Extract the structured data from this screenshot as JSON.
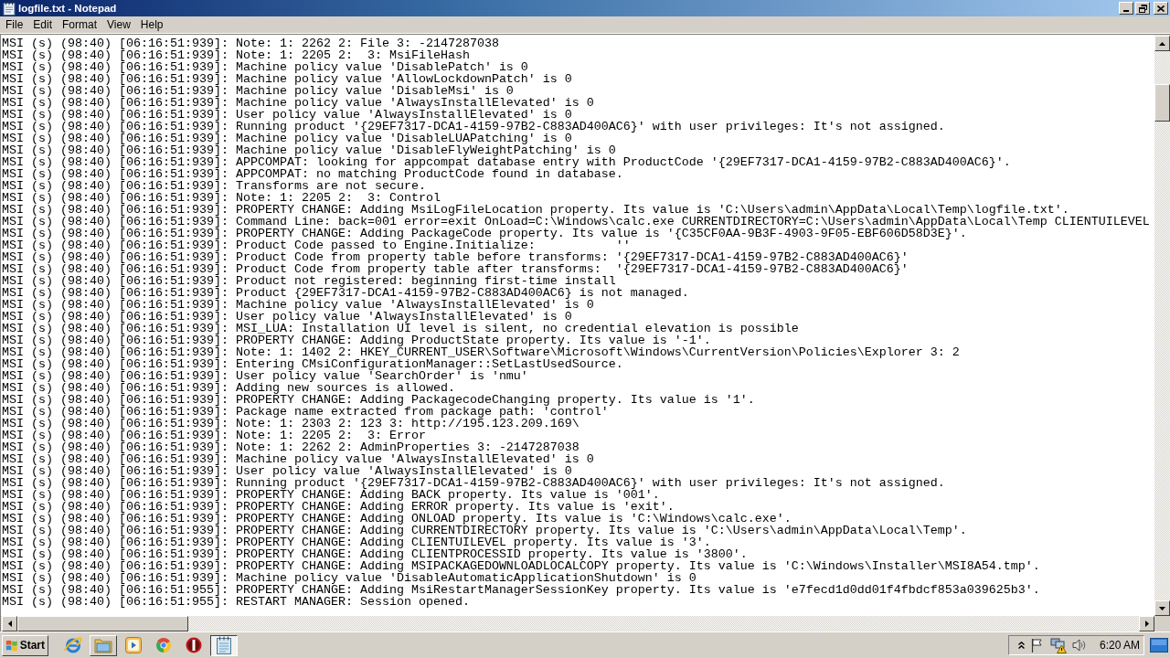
{
  "window": {
    "title": "logfile.txt - Notepad"
  },
  "menu": [
    "File",
    "Edit",
    "Format",
    "View",
    "Help"
  ],
  "document": {
    "lines": [
      "MSI (s) (98:40) [06:16:51:939]: Note: 1: 2262 2: File 3: -2147287038",
      "MSI (s) (98:40) [06:16:51:939]: Note: 1: 2205 2:  3: MsiFileHash",
      "MSI (s) (98:40) [06:16:51:939]: Machine policy value 'DisablePatch' is 0",
      "MSI (s) (98:40) [06:16:51:939]: Machine policy value 'AllowLockdownPatch' is 0",
      "MSI (s) (98:40) [06:16:51:939]: Machine policy value 'DisableMsi' is 0",
      "MSI (s) (98:40) [06:16:51:939]: Machine policy value 'AlwaysInstallElevated' is 0",
      "MSI (s) (98:40) [06:16:51:939]: User policy value 'AlwaysInstallElevated' is 0",
      "MSI (s) (98:40) [06:16:51:939]: Running product '{29EF7317-DCA1-4159-97B2-C883AD400AC6}' with user privileges: It's not assigned.",
      "MSI (s) (98:40) [06:16:51:939]: Machine policy value 'DisableLUAPatching' is 0",
      "MSI (s) (98:40) [06:16:51:939]: Machine policy value 'DisableFlyWeightPatching' is 0",
      "MSI (s) (98:40) [06:16:51:939]: APPCOMPAT: looking for appcompat database entry with ProductCode '{29EF7317-DCA1-4159-97B2-C883AD400AC6}'.",
      "MSI (s) (98:40) [06:16:51:939]: APPCOMPAT: no matching ProductCode found in database.",
      "MSI (s) (98:40) [06:16:51:939]: Transforms are not secure.",
      "MSI (s) (98:40) [06:16:51:939]: Note: 1: 2205 2:  3: Control",
      "MSI (s) (98:40) [06:16:51:939]: PROPERTY CHANGE: Adding MsiLogFileLocation property. Its value is 'C:\\Users\\admin\\AppData\\Local\\Temp\\logfile.txt'.",
      "MSI (s) (98:40) [06:16:51:939]: Command Line: back=001 error=exit OnLoad=C:\\Windows\\calc.exe CURRENTDIRECTORY=C:\\Users\\admin\\AppData\\Local\\Temp CLIENTUILEVEL",
      "MSI (s) (98:40) [06:16:51:939]: PROPERTY CHANGE: Adding PackageCode property. Its value is '{C35CF0AA-9B3F-4903-9F05-EBF606D58D3E}'.",
      "MSI (s) (98:40) [06:16:51:939]: Product Code passed to Engine.Initialize:           ''",
      "MSI (s) (98:40) [06:16:51:939]: Product Code from property table before transforms: '{29EF7317-DCA1-4159-97B2-C883AD400AC6}'",
      "MSI (s) (98:40) [06:16:51:939]: Product Code from property table after transforms:  '{29EF7317-DCA1-4159-97B2-C883AD400AC6}'",
      "MSI (s) (98:40) [06:16:51:939]: Product not registered: beginning first-time install",
      "MSI (s) (98:40) [06:16:51:939]: Product {29EF7317-DCA1-4159-97B2-C883AD400AC6} is not managed.",
      "MSI (s) (98:40) [06:16:51:939]: Machine policy value 'AlwaysInstallElevated' is 0",
      "MSI (s) (98:40) [06:16:51:939]: User policy value 'AlwaysInstallElevated' is 0",
      "MSI (s) (98:40) [06:16:51:939]: MSI_LUA: Installation UI level is silent, no credential elevation is possible",
      "MSI (s) (98:40) [06:16:51:939]: PROPERTY CHANGE: Adding ProductState property. Its value is '-1'.",
      "MSI (s) (98:40) [06:16:51:939]: Note: 1: 1402 2: HKEY_CURRENT_USER\\Software\\Microsoft\\Windows\\CurrentVersion\\Policies\\Explorer 3: 2",
      "MSI (s) (98:40) [06:16:51:939]: Entering CMsiConfigurationManager::SetLastUsedSource.",
      "MSI (s) (98:40) [06:16:51:939]: User policy value 'SearchOrder' is 'nmu'",
      "MSI (s) (98:40) [06:16:51:939]: Adding new sources is allowed.",
      "MSI (s) (98:40) [06:16:51:939]: PROPERTY CHANGE: Adding PackagecodeChanging property. Its value is '1'.",
      "MSI (s) (98:40) [06:16:51:939]: Package name extracted from package path: 'control'",
      "MSI (s) (98:40) [06:16:51:939]: Note: 1: 2303 2: 123 3: http://195.123.209.169\\",
      "MSI (s) (98:40) [06:16:51:939]: Note: 1: 2205 2:  3: Error",
      "MSI (s) (98:40) [06:16:51:939]: Note: 1: 2262 2: AdminProperties 3: -2147287038",
      "MSI (s) (98:40) [06:16:51:939]: Machine policy value 'AlwaysInstallElevated' is 0",
      "MSI (s) (98:40) [06:16:51:939]: User policy value 'AlwaysInstallElevated' is 0",
      "MSI (s) (98:40) [06:16:51:939]: Running product '{29EF7317-DCA1-4159-97B2-C883AD400AC6}' with user privileges: It's not assigned.",
      "MSI (s) (98:40) [06:16:51:939]: PROPERTY CHANGE: Adding BACK property. Its value is '001'.",
      "MSI (s) (98:40) [06:16:51:939]: PROPERTY CHANGE: Adding ERROR property. Its value is 'exit'.",
      "MSI (s) (98:40) [06:16:51:939]: PROPERTY CHANGE: Adding ONLOAD property. Its value is 'C:\\Windows\\calc.exe'.",
      "MSI (s) (98:40) [06:16:51:939]: PROPERTY CHANGE: Adding CURRENTDIRECTORY property. Its value is 'C:\\Users\\admin\\AppData\\Local\\Temp'.",
      "MSI (s) (98:40) [06:16:51:939]: PROPERTY CHANGE: Adding CLIENTUILEVEL property. Its value is '3'.",
      "MSI (s) (98:40) [06:16:51:939]: PROPERTY CHANGE: Adding CLIENTPROCESSID property. Its value is '3800'.",
      "MSI (s) (98:40) [06:16:51:939]: PROPERTY CHANGE: Adding MSIPACKAGEDOWNLOADLOCALCOPY property. Its value is 'C:\\Windows\\Installer\\MSI8A54.tmp'.",
      "MSI (s) (98:40) [06:16:51:939]: Machine policy value 'DisableAutomaticApplicationShutdown' is 0",
      "MSI (s) (98:40) [06:16:51:955]: PROPERTY CHANGE: Adding MsiRestartManagerSessionKey property. Its value is 'e7fecd1d0dd01f4fbdcf853a039625b3'.",
      "MSI (s) (98:40) [06:16:51:955]: RESTART MANAGER: Session opened."
    ]
  },
  "taskbar": {
    "start": "Start",
    "apps": [
      {
        "kind": "globe",
        "open": false,
        "selected": false
      },
      {
        "kind": "folder",
        "open": true,
        "selected": false
      },
      {
        "kind": "player",
        "open": false,
        "selected": false
      },
      {
        "kind": "browser",
        "open": false,
        "selected": false
      },
      {
        "kind": "circle",
        "open": false,
        "selected": false
      },
      {
        "kind": "notepad",
        "open": true,
        "selected": true
      }
    ],
    "clock": "6:20 AM"
  }
}
